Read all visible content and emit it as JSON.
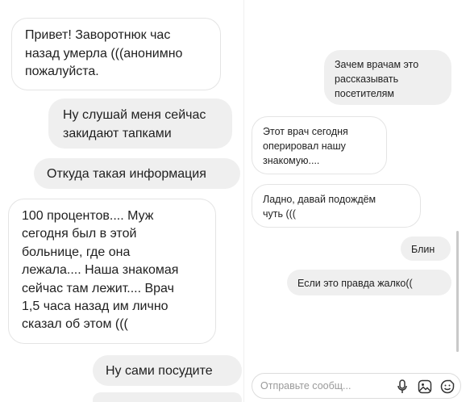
{
  "left_chat": {
    "messages": [
      {
        "text": "Привет! Заворотнюк час\nназад умерла (((анонимно\nпожалуйста.",
        "type": "incoming"
      },
      {
        "text": "Ну слушай меня сейчас\nзакидают тапками",
        "type": "outgoing"
      },
      {
        "text": "Откуда такая информация",
        "type": "outgoing"
      },
      {
        "text": "100 процентов.... Муж\nсегодня был в этой\nбольнице, где она\nлежала.... Наша знакомая\nсейчас там лежит.... Врач\n1,5 часа назад им лично\nсказал об этом (((",
        "type": "incoming"
      },
      {
        "text": "Ну сами посудите",
        "type": "outgoing"
      }
    ]
  },
  "right_chat": {
    "messages": [
      {
        "text": "Зачем врачам это\nрассказывать\nпосетителям",
        "type": "outgoing"
      },
      {
        "text": "Этот врач сегодня\nоперировал нашу\nзнакомую....",
        "type": "incoming"
      },
      {
        "text": "Ладно, давай подождём\nчуть (((",
        "type": "incoming"
      },
      {
        "text": "Блин",
        "type": "outgoing"
      },
      {
        "text": "Если это правда жалко((",
        "type": "outgoing"
      }
    ],
    "composer": {
      "placeholder": "Отправьте сообщ...",
      "icons": [
        "microphone-icon",
        "image-icon",
        "sticker-icon"
      ]
    }
  }
}
